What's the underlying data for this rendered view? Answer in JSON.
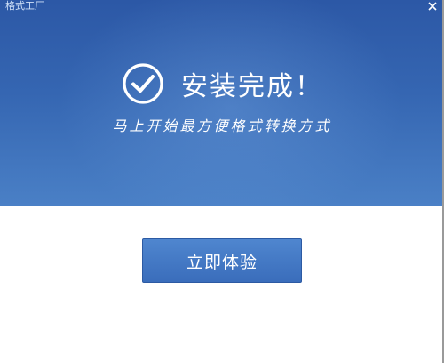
{
  "window": {
    "title": "格式工厂"
  },
  "success": {
    "icon": "check-circle-icon",
    "title": "安装完成！",
    "subtitle": "马上开始最方便格式转换方式"
  },
  "actions": {
    "start_label": "立即体验"
  },
  "colors": {
    "banner_top": "#2c58a6",
    "banner_bottom": "#4a80c6",
    "button": "#3a6dbb",
    "text_on_blue": "#ffffff"
  }
}
